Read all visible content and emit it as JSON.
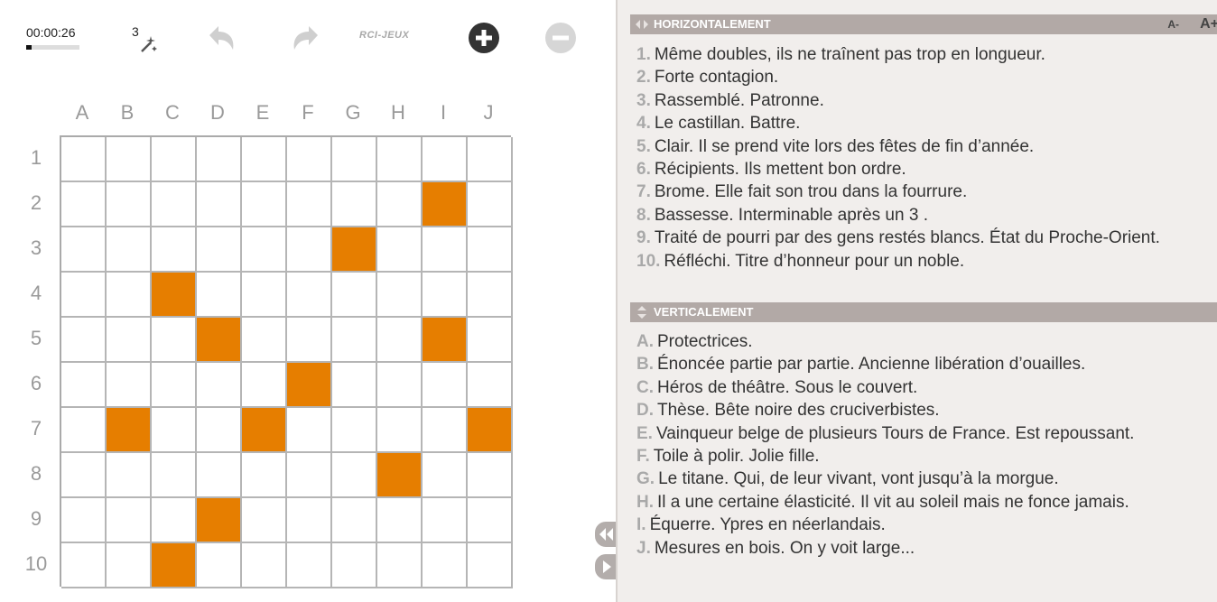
{
  "toolbar": {
    "timer": "00:00:26",
    "timer_progress": 0.1,
    "hints_left": "3",
    "logo_text": "RCI-JEUX",
    "icons": [
      "magic-wand-icon",
      "undo-icon",
      "redo-icon",
      "zoom-in-icon",
      "zoom-out-icon"
    ]
  },
  "grid": {
    "columns": [
      "A",
      "B",
      "C",
      "D",
      "E",
      "F",
      "G",
      "H",
      "I",
      "J"
    ],
    "rows": [
      "1",
      "2",
      "3",
      "4",
      "5",
      "6",
      "7",
      "8",
      "9",
      "10"
    ],
    "black_cells": [
      [
        2,
        9
      ],
      [
        3,
        7
      ],
      [
        4,
        3
      ],
      [
        5,
        4
      ],
      [
        5,
        9
      ],
      [
        6,
        6
      ],
      [
        7,
        2
      ],
      [
        7,
        5
      ],
      [
        7,
        10
      ],
      [
        8,
        8
      ],
      [
        9,
        4
      ],
      [
        10,
        3
      ]
    ],
    "black_color": "#e67e00"
  },
  "horizontal": {
    "title": "HORIZONTALEMENT",
    "font_minus": "A-",
    "font_plus": "A+",
    "clues": [
      {
        "num": "1.",
        "text": "Même doubles, ils ne traînent pas trop en longueur."
      },
      {
        "num": "2.",
        "text": "Forte contagion."
      },
      {
        "num": "3.",
        "text": "Rassemblé. Patronne."
      },
      {
        "num": "4.",
        "text": "Le castillan. Battre."
      },
      {
        "num": "5.",
        "text": "Clair. Il se prend vite lors des fêtes de fin d’année."
      },
      {
        "num": "6.",
        "text": "Récipients. Ils mettent bon ordre."
      },
      {
        "num": "7.",
        "text": "Brome. Elle fait son trou dans la fourrure."
      },
      {
        "num": "8.",
        "text": "Bassesse. Interminable après un 3 ."
      },
      {
        "num": "9.",
        "text": "Traité de pourri par des gens restés blancs. État du Proche-Orient."
      },
      {
        "num": "10.",
        "text": "Réfléchi. Titre d’honneur pour un noble."
      }
    ]
  },
  "vertical": {
    "title": "VERTICALEMENT",
    "clues": [
      {
        "num": "A.",
        "text": "Protectrices."
      },
      {
        "num": "B.",
        "text": "Énoncée partie par partie. Ancienne libération d’ouailles."
      },
      {
        "num": "C.",
        "text": "Héros de théâtre. Sous le couvert."
      },
      {
        "num": "D.",
        "text": "Thèse. Bête noire des cruciverbistes."
      },
      {
        "num": "E.",
        "text": "Vainqueur belge de plusieurs Tours de France. Est repoussant."
      },
      {
        "num": "F.",
        "text": "Toile à polir. Jolie fille."
      },
      {
        "num": "G.",
        "text": "Le titane. Qui, de leur vivant, vont jusqu’à la morgue."
      },
      {
        "num": "H.",
        "text": "Il a une certaine élasticité. Il vit au soleil mais ne fonce jamais."
      },
      {
        "num": "I.",
        "text": "Équerre. Ypres en néerlandais."
      },
      {
        "num": "J.",
        "text": "Mesures en bois. On y voit large..."
      }
    ]
  }
}
